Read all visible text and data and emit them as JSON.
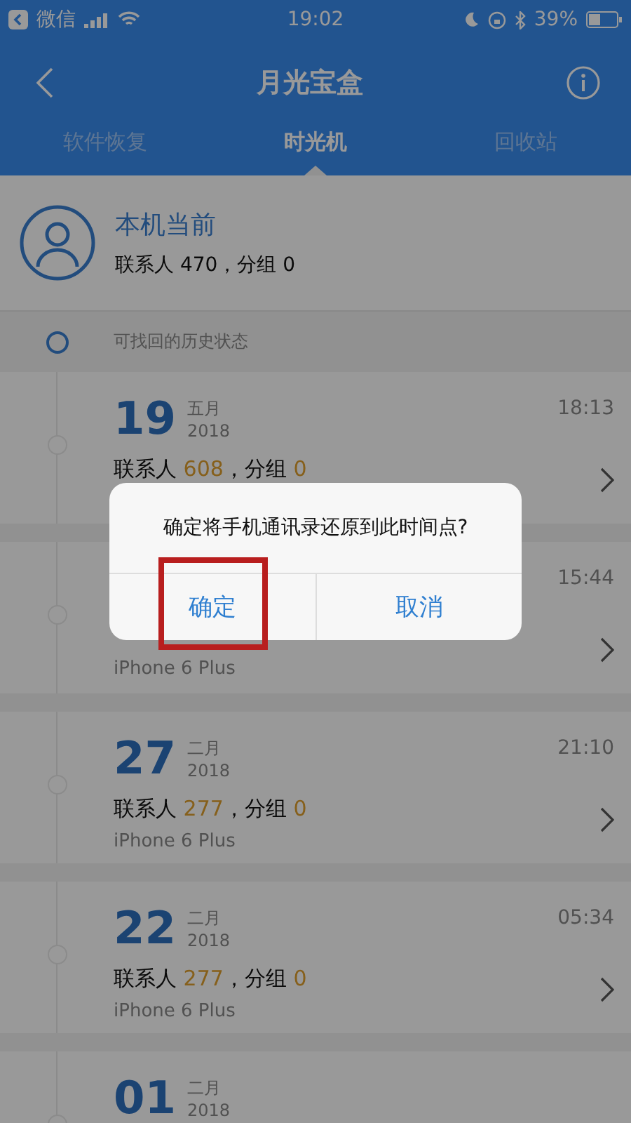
{
  "status_bar": {
    "back_app": "微信",
    "time": "19:02",
    "battery": "39%"
  },
  "nav": {
    "title": "月光宝盒"
  },
  "tabs": [
    {
      "label": "软件恢复",
      "selected": false
    },
    {
      "label": "时光机",
      "selected": true
    },
    {
      "label": "回收站",
      "selected": false
    }
  ],
  "current": {
    "title": "本机当前",
    "summary": "联系人 470，分组 0"
  },
  "history_header": "可找回的历史状态",
  "entries": [
    {
      "day": "19",
      "month": "五月",
      "year": "2018",
      "time": "18:13",
      "contacts_prefix": "联系人",
      "contacts": "608",
      "groups_prefix": "，分组",
      "groups": "0"
    },
    {
      "time": "15:44",
      "device": "iPhone 6 Plus"
    },
    {
      "day": "27",
      "month": "二月",
      "year": "2018",
      "time": "21:10",
      "contacts_prefix": "联系人",
      "contacts": "277",
      "groups_prefix": "，分组",
      "groups": "0",
      "device": "iPhone 6 Plus"
    },
    {
      "day": "22",
      "month": "二月",
      "year": "2018",
      "time": "05:34",
      "contacts_prefix": "联系人",
      "contacts": "277",
      "groups_prefix": "，分组",
      "groups": "0",
      "device": "iPhone 6 Plus"
    },
    {
      "day": "01",
      "month": "二月",
      "year": "2018"
    }
  ],
  "dialog": {
    "message": "确定将手机通讯录还原到此时间点?",
    "buttons": [
      {
        "label": "确定",
        "highlighted": true
      },
      {
        "label": "取消",
        "highlighted": false
      }
    ]
  }
}
